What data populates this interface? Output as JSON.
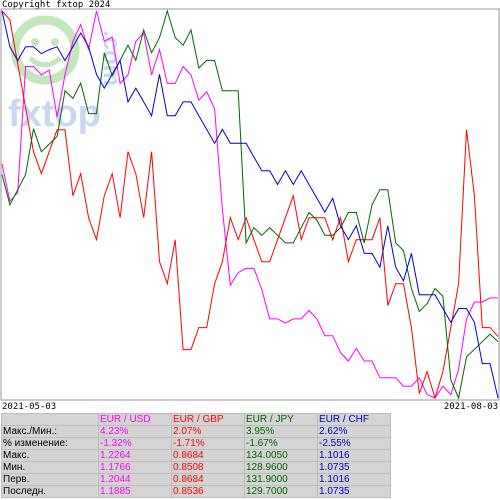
{
  "copyright": "Copyright fxtop 2024",
  "watermark": {
    "text": "fxtop",
    "domain": ".com",
    "color": "#bfe0b8"
  },
  "chart_data": {
    "type": "line",
    "x_start_label": "2021-05-03",
    "x_end_label": "2021-08-03",
    "series": [
      {
        "name": "EUR / USD",
        "color": "#ff00ff",
        "values": [
          1.2044,
          1.2,
          1.201,
          1.216,
          1.216,
          1.215,
          1.2156,
          1.21,
          1.215,
          1.219,
          1.221,
          1.218,
          1.2226,
          1.219,
          1.2195,
          1.214,
          1.215,
          1.219,
          1.22,
          1.215,
          1.218,
          1.214,
          1.214,
          1.216,
          1.215,
          1.212,
          1.213,
          1.211,
          1.199,
          1.19,
          1.1915,
          1.192,
          1.192,
          1.1895,
          1.186,
          1.186,
          1.1855,
          1.186,
          1.186,
          1.187,
          1.186,
          1.184,
          1.184,
          1.182,
          1.181,
          1.1825,
          1.181,
          1.181,
          1.179,
          1.179,
          1.179,
          1.178,
          1.178,
          1.179,
          1.177,
          1.1766,
          1.178,
          1.177,
          1.18,
          1.186,
          1.188,
          1.188,
          1.1885,
          1.1885
        ]
      },
      {
        "name": "EUR / GBP",
        "color": "#ff0000",
        "values": [
          0.8684,
          0.868,
          0.866,
          0.864,
          0.862,
          0.861,
          0.862,
          0.863,
          0.863,
          0.86,
          0.861,
          0.859,
          0.858,
          0.86,
          0.861,
          0.859,
          0.862,
          0.861,
          0.859,
          0.862,
          0.857,
          0.856,
          0.858,
          0.853,
          0.853,
          0.854,
          0.854,
          0.856,
          0.857,
          0.859,
          0.858,
          0.859,
          0.858,
          0.857,
          0.857,
          0.858,
          0.859,
          0.86,
          0.858,
          0.859,
          0.859,
          0.859,
          0.858,
          0.859,
          0.857,
          0.858,
          0.858,
          0.858,
          0.859,
          0.855,
          0.856,
          0.856,
          0.854,
          0.851,
          0.852,
          0.8508,
          0.852,
          0.854,
          0.856,
          0.863,
          0.86,
          0.854,
          0.854,
          0.8536
        ]
      },
      {
        "name": "EUR / JPY",
        "color": "#006600",
        "values": [
          131.9,
          131.5,
          131.7,
          131.9,
          132.5,
          132.2,
          132.3,
          132.4,
          133.0,
          132.9,
          133.1,
          132.7,
          132.7,
          133.5,
          133.2,
          133.4,
          133.6,
          133.4,
          133.8,
          133.5,
          133.7,
          134.05,
          133.7,
          133.6,
          133.8,
          133.3,
          133.4,
          133.4,
          133.0,
          133.0,
          133.0,
          131.0,
          131.2,
          131.1,
          131.2,
          131.1,
          131.0,
          131.0,
          131.2,
          131.4,
          131.3,
          131.1,
          131.1,
          131.2,
          131.4,
          131.4,
          131.0,
          131.5,
          131.7,
          131.7,
          131.0,
          130.9,
          130.4,
          130.1,
          130.2,
          130.4,
          130.3,
          129.2,
          128.96,
          129.5,
          129.6,
          129.7,
          129.8,
          129.7
        ]
      },
      {
        "name": "EUR / CHF",
        "color": "#0000cc",
        "values": [
          1.1016,
          1.099,
          1.098,
          1.099,
          1.099,
          1.0985,
          1.0988,
          1.099,
          1.098,
          1.099,
          1.1,
          1.099,
          1.097,
          1.096,
          1.097,
          1.098,
          1.095,
          1.096,
          1.095,
          1.094,
          1.097,
          1.094,
          1.094,
          1.095,
          1.095,
          1.094,
          1.093,
          1.092,
          1.093,
          1.092,
          1.092,
          1.092,
          1.091,
          1.09,
          1.09,
          1.089,
          1.09,
          1.089,
          1.09,
          1.089,
          1.088,
          1.087,
          1.088,
          1.086,
          1.085,
          1.086,
          1.084,
          1.084,
          1.083,
          1.086,
          1.083,
          1.082,
          1.084,
          1.081,
          1.081,
          1.081,
          1.08,
          1.079,
          1.08,
          1.08,
          1.079,
          1.076,
          1.076,
          1.0735
        ]
      }
    ]
  },
  "stats_table": {
    "headers": [
      "EUR / USD",
      "EUR / GBP",
      "EUR / JPY",
      "EUR / CHF"
    ],
    "header_colors": [
      "#ff00ff",
      "#ff0000",
      "#006600",
      "#0000cc"
    ],
    "rows": [
      {
        "label": "Макс./Мин.:",
        "values": [
          "4.23%",
          "2.07%",
          "3.95%",
          "2.62%"
        ]
      },
      {
        "label": "% изменение:",
        "values": [
          "-1.32%",
          "-1.71%",
          "-1.67%",
          "-2.55%"
        ]
      },
      {
        "label": "Макс.",
        "values": [
          "1.2264",
          "0.8684",
          "134.0050",
          "1.1016"
        ]
      },
      {
        "label": "Мин.",
        "values": [
          "1.1766",
          "0.8508",
          "128.9600",
          "1.0735"
        ]
      },
      {
        "label": "Перв.",
        "values": [
          "1.2044",
          "0.8684",
          "131.9000",
          "1.1016"
        ]
      },
      {
        "label": "Последн.",
        "values": [
          "1.1885",
          "0.8536",
          "129.7000",
          "1.0735"
        ]
      }
    ]
  }
}
